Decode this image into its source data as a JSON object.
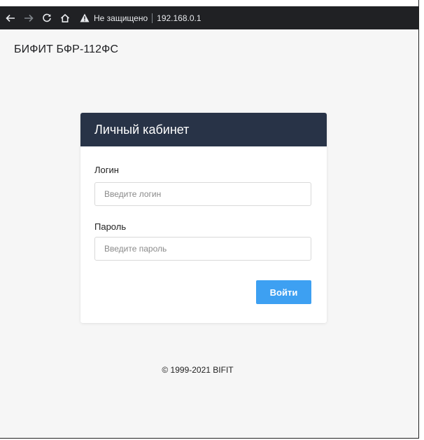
{
  "browser": {
    "security_label": "Не защищено",
    "url": "192.168.0.1"
  },
  "page": {
    "brand": "БИФИТ БФР-112ФС",
    "footer": "© 1999-2021 BIFIT"
  },
  "login_card": {
    "title": "Личный кабинет",
    "login_label": "Логин",
    "login_placeholder": "Введите логин",
    "login_value": "",
    "password_label": "Пароль",
    "password_placeholder": "Введите пароль",
    "password_value": "",
    "submit_label": "Войти"
  },
  "colors": {
    "header_bg": "#283347",
    "button_bg": "#3da0f2",
    "page_bg": "#f6f6f6"
  },
  "icons": [
    "back-arrow-icon",
    "forward-arrow-icon",
    "reload-icon",
    "home-icon",
    "warning-icon"
  ]
}
